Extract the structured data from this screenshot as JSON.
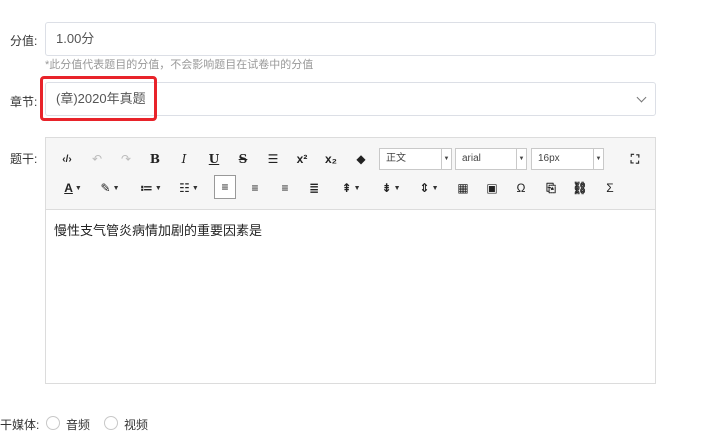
{
  "score": {
    "label": "分值:",
    "value": "1.00分",
    "hint": "*此分值代表题目的分值，不会影响题目在试卷中的分值"
  },
  "chapter": {
    "label": "章节:",
    "value": "(章)2020年真题"
  },
  "question": {
    "label": "题干:",
    "content": "慢性支气管炎病情加剧的重要因素是"
  },
  "toolbar": {
    "paragraph_format": "正文",
    "font_family": "arial",
    "font_size": "16px",
    "row1_icons": [
      "source-code-icon",
      "undo-icon",
      "redo-icon",
      "bold-icon",
      "italic-icon",
      "underline-icon",
      "strikethrough-icon",
      "horizontal-rule-icon",
      "superscript-icon",
      "subscript-icon",
      "clear-format-icon"
    ],
    "row2_icons": [
      "font-color-icon",
      "background-color-icon",
      "ordered-list-icon",
      "unordered-list-icon",
      "align-left-icon",
      "align-center-icon",
      "align-right-icon",
      "align-justify-icon",
      "row-spacing-top-icon",
      "row-spacing-bottom-icon",
      "line-height-icon",
      "table-icon",
      "image-icon",
      "special-char-icon",
      "paste-icon",
      "link-icon",
      "formula-icon"
    ]
  },
  "media": {
    "label": "干媒体:",
    "options": [
      "音频",
      "视频"
    ]
  },
  "colors": {
    "highlight": "#e8232a",
    "border": "#dcdfe6",
    "toolbar_bg": "#f6f6f6"
  }
}
